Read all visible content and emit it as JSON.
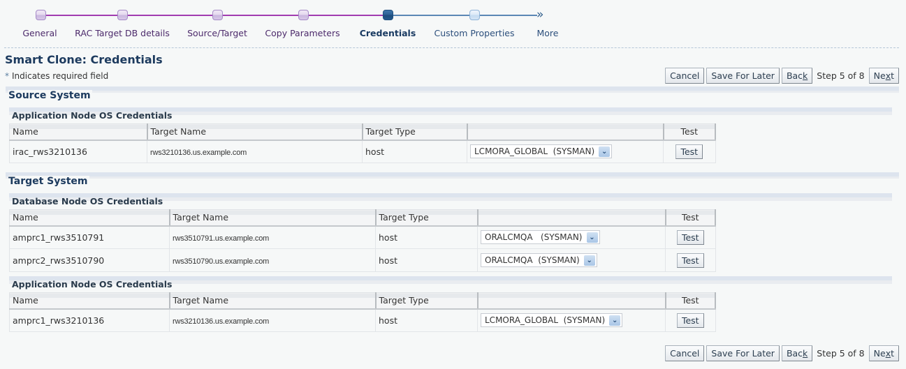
{
  "train": {
    "steps": [
      {
        "label": "General",
        "state": "visited"
      },
      {
        "label": "RAC Target DB details",
        "state": "visited"
      },
      {
        "label": "Source/Target",
        "state": "visited"
      },
      {
        "label": "Copy Parameters",
        "state": "visited"
      },
      {
        "label": "Credentials",
        "state": "current"
      },
      {
        "label": "Custom Properties",
        "state": "future"
      },
      {
        "label": "More",
        "state": "more"
      }
    ],
    "more_icon": "double-chevron-right-icon",
    "colors": {
      "visited": "#a23db0",
      "current": "#1e4f7e",
      "future": "#5b87b5"
    }
  },
  "page": {
    "title": "Smart Clone: Credentials",
    "required_star": "*",
    "required_note": "Indicates required field"
  },
  "nav": {
    "cancel": "Cancel",
    "save_for_later": "Save For Later",
    "back_pre": "Bac",
    "back_access": "k",
    "step_text": "Step 5 of 8",
    "next_pre": "Ne",
    "next_access": "x",
    "next_post": "t"
  },
  "source_system": {
    "title": "Source System",
    "app_node": {
      "title": "Application Node OS Credentials",
      "columns": [
        "Name",
        "Target Name",
        "Target Type",
        "",
        "Test"
      ],
      "rows": [
        {
          "name": "irac_rws3210136",
          "target_name": "rws3210136.us.example.com",
          "target_type": "host",
          "credential": "LCMORA_GLOBAL  (SYSMAN)",
          "test_label": "Test"
        }
      ]
    }
  },
  "target_system": {
    "title": "Target System",
    "db_node": {
      "title": "Database Node OS Credentials",
      "columns": [
        "Name",
        "Target Name",
        "Target Type",
        "",
        "Test"
      ],
      "rows": [
        {
          "name": "amprc1_rws3510791",
          "target_name": "rws3510791.us.example.com",
          "target_type": "host",
          "credential": "ORALCMQA   (SYSMAN)",
          "test_label": "Test"
        },
        {
          "name": "amprc2_rws3510790",
          "target_name": "rws3510790.us.example.com",
          "target_type": "host",
          "credential": "ORALCMQA  (SYSMAN)",
          "test_label": "Test"
        }
      ]
    },
    "app_node": {
      "title": "Application Node OS Credentials",
      "columns": [
        "Name",
        "Target Name",
        "Target Type",
        "",
        "Test"
      ],
      "rows": [
        {
          "name": "amprc1_rws3210136",
          "target_name": "rws3210136.us.example.com",
          "target_type": "host",
          "credential": "LCMORA_GLOBAL  (SYSMAN)",
          "test_label": "Test"
        }
      ]
    }
  }
}
